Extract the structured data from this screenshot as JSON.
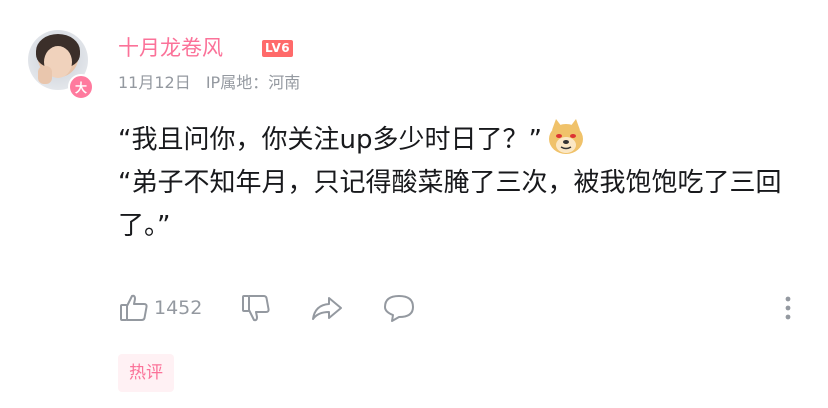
{
  "user": {
    "name": "十月龙卷风",
    "level": "LV6",
    "avatar_badge": "大",
    "date": "11月12日",
    "ip_location": "IP属地：河南"
  },
  "comment": {
    "line1": "“我且问你，你关注up多少时日了？”",
    "line2": "“弟子不知年月，只记得酸菜腌了三次，被我饱饱吃了三回了。”",
    "emoji": "doge-emoji"
  },
  "actions": {
    "like_count": "1452"
  },
  "tag": {
    "label": "热评"
  },
  "colors": {
    "accent": "#fb7299",
    "meta_text": "#9499a0",
    "body_text": "#18191c",
    "level_badge": "#ff6a6a"
  }
}
